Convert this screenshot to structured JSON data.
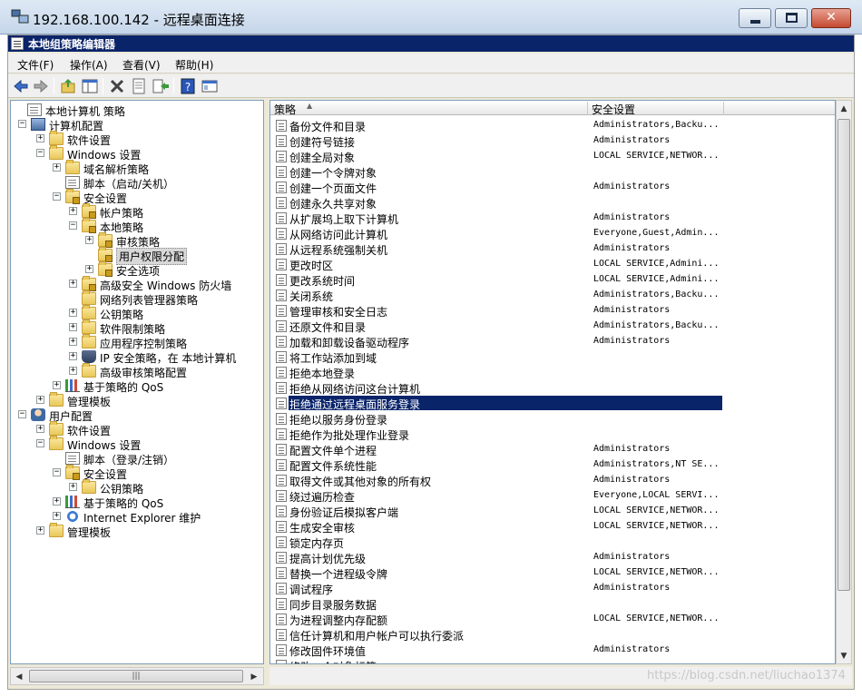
{
  "rdp": {
    "title": "192.168.100.142 - 远程桌面连接",
    "buttons": {
      "minimize": "minimize",
      "maximize": "maximize",
      "close": "✕"
    }
  },
  "app": {
    "title": "本地组策略编辑器",
    "menu": [
      "文件(F)",
      "操作(A)",
      "查看(V)",
      "帮助(H)"
    ],
    "toolbar_icons": [
      "back-arrow-icon",
      "forward-arrow-icon",
      "up-folder-icon",
      "show-hide-tree-icon",
      "delete-icon",
      "properties-icon",
      "export-list-icon",
      "help-icon",
      "view-icon"
    ]
  },
  "tree": [
    {
      "label": "本地计算机 策略",
      "icon": "doc",
      "exp": ""
    },
    {
      "label": "计算机配置",
      "icon": "computer",
      "exp": "−"
    },
    {
      "label": "软件设置",
      "icon": "folder",
      "exp": "+"
    },
    {
      "label": "Windows 设置",
      "icon": "folder",
      "exp": "−"
    },
    {
      "label": "域名解析策略",
      "icon": "folder",
      "exp": "+"
    },
    {
      "label": "脚本（启动/关机）",
      "icon": "doc",
      "exp": ""
    },
    {
      "label": "安全设置",
      "icon": "lock-folder",
      "exp": "−"
    },
    {
      "label": "帐户策略",
      "icon": "lock-folder",
      "exp": "+"
    },
    {
      "label": "本地策略",
      "icon": "lock-folder",
      "exp": "−"
    },
    {
      "label": "审核策略",
      "icon": "lock-folder",
      "exp": "+"
    },
    {
      "label": "用户权限分配",
      "icon": "lock-folder",
      "exp": "",
      "selected": true
    },
    {
      "label": "安全选项",
      "icon": "lock-folder",
      "exp": "+"
    },
    {
      "label": "高级安全 Windows 防火墙",
      "icon": "lock-folder",
      "exp": "+"
    },
    {
      "label": "网络列表管理器策略",
      "icon": "folder",
      "exp": ""
    },
    {
      "label": "公钥策略",
      "icon": "folder",
      "exp": "+"
    },
    {
      "label": "软件限制策略",
      "icon": "folder",
      "exp": "+"
    },
    {
      "label": "应用程序控制策略",
      "icon": "folder",
      "exp": "+"
    },
    {
      "label": "IP 安全策略，在 本地计算机",
      "icon": "shield",
      "exp": "+"
    },
    {
      "label": "高级审核策略配置",
      "icon": "folder",
      "exp": "+"
    },
    {
      "label": "基于策略的 QoS",
      "icon": "chart",
      "exp": "+"
    },
    {
      "label": "管理模板",
      "icon": "folder",
      "exp": "+"
    },
    {
      "label": "用户配置",
      "icon": "user",
      "exp": "−"
    },
    {
      "label": "软件设置",
      "icon": "folder",
      "exp": "+"
    },
    {
      "label": "Windows 设置",
      "icon": "folder",
      "exp": "−"
    },
    {
      "label": "脚本（登录/注销）",
      "icon": "doc",
      "exp": ""
    },
    {
      "label": "安全设置",
      "icon": "lock-folder",
      "exp": "−"
    },
    {
      "label": "公钥策略",
      "icon": "folder",
      "exp": "+"
    },
    {
      "label": "基于策略的 QoS",
      "icon": "chart",
      "exp": "+"
    },
    {
      "label": "Internet Explorer 维护",
      "icon": "ie",
      "exp": "+"
    },
    {
      "label": "管理模板",
      "icon": "folder",
      "exp": "+"
    }
  ],
  "list": {
    "columns": [
      "策略",
      "安全设置"
    ],
    "rows": [
      [
        "备份文件和目录",
        "Administrators,Backu..."
      ],
      [
        "创建符号链接",
        "Administrators"
      ],
      [
        "创建全局对象",
        "LOCAL SERVICE,NETWOR..."
      ],
      [
        "创建一个令牌对象",
        ""
      ],
      [
        "创建一个页面文件",
        "Administrators"
      ],
      [
        "创建永久共享对象",
        ""
      ],
      [
        "从扩展坞上取下计算机",
        "Administrators"
      ],
      [
        "从网络访问此计算机",
        "Everyone,Guest,Admin..."
      ],
      [
        "从远程系统强制关机",
        "Administrators"
      ],
      [
        "更改时区",
        "LOCAL SERVICE,Admini..."
      ],
      [
        "更改系统时间",
        "LOCAL SERVICE,Admini..."
      ],
      [
        "关闭系统",
        "Administrators,Backu..."
      ],
      [
        "管理审核和安全日志",
        "Administrators"
      ],
      [
        "还原文件和目录",
        "Administrators,Backu..."
      ],
      [
        "加载和卸载设备驱动程序",
        "Administrators"
      ],
      [
        "将工作站添加到域",
        ""
      ],
      [
        "拒绝本地登录",
        ""
      ],
      [
        "拒绝从网络访问这台计算机",
        ""
      ],
      [
        "拒绝通过远程桌面服务登录",
        ""
      ],
      [
        "拒绝以服务身份登录",
        ""
      ],
      [
        "拒绝作为批处理作业登录",
        ""
      ],
      [
        "配置文件单个进程",
        "Administrators"
      ],
      [
        "配置文件系统性能",
        "Administrators,NT SE..."
      ],
      [
        "取得文件或其他对象的所有权",
        "Administrators"
      ],
      [
        "绕过遍历检查",
        "Everyone,LOCAL SERVI..."
      ],
      [
        "身份验证后模拟客户端",
        "LOCAL SERVICE,NETWOR..."
      ],
      [
        "生成安全审核",
        "LOCAL SERVICE,NETWOR..."
      ],
      [
        "锁定内存页",
        ""
      ],
      [
        "提高计划优先级",
        "Administrators"
      ],
      [
        "替换一个进程级令牌",
        "LOCAL SERVICE,NETWOR..."
      ],
      [
        "调试程序",
        "Administrators"
      ],
      [
        "同步目录服务数据",
        ""
      ],
      [
        "为进程调整内存配额",
        "LOCAL SERVICE,NETWOR..."
      ],
      [
        "信任计算机和用户帐户可以执行委派",
        ""
      ],
      [
        "修改固件环境值",
        "Administrators"
      ],
      [
        "修改一个对象标签",
        ""
      ]
    ],
    "selected_index": 18
  },
  "status": {
    "watermark": "https://blog.csdn.net/liuchao1374"
  }
}
